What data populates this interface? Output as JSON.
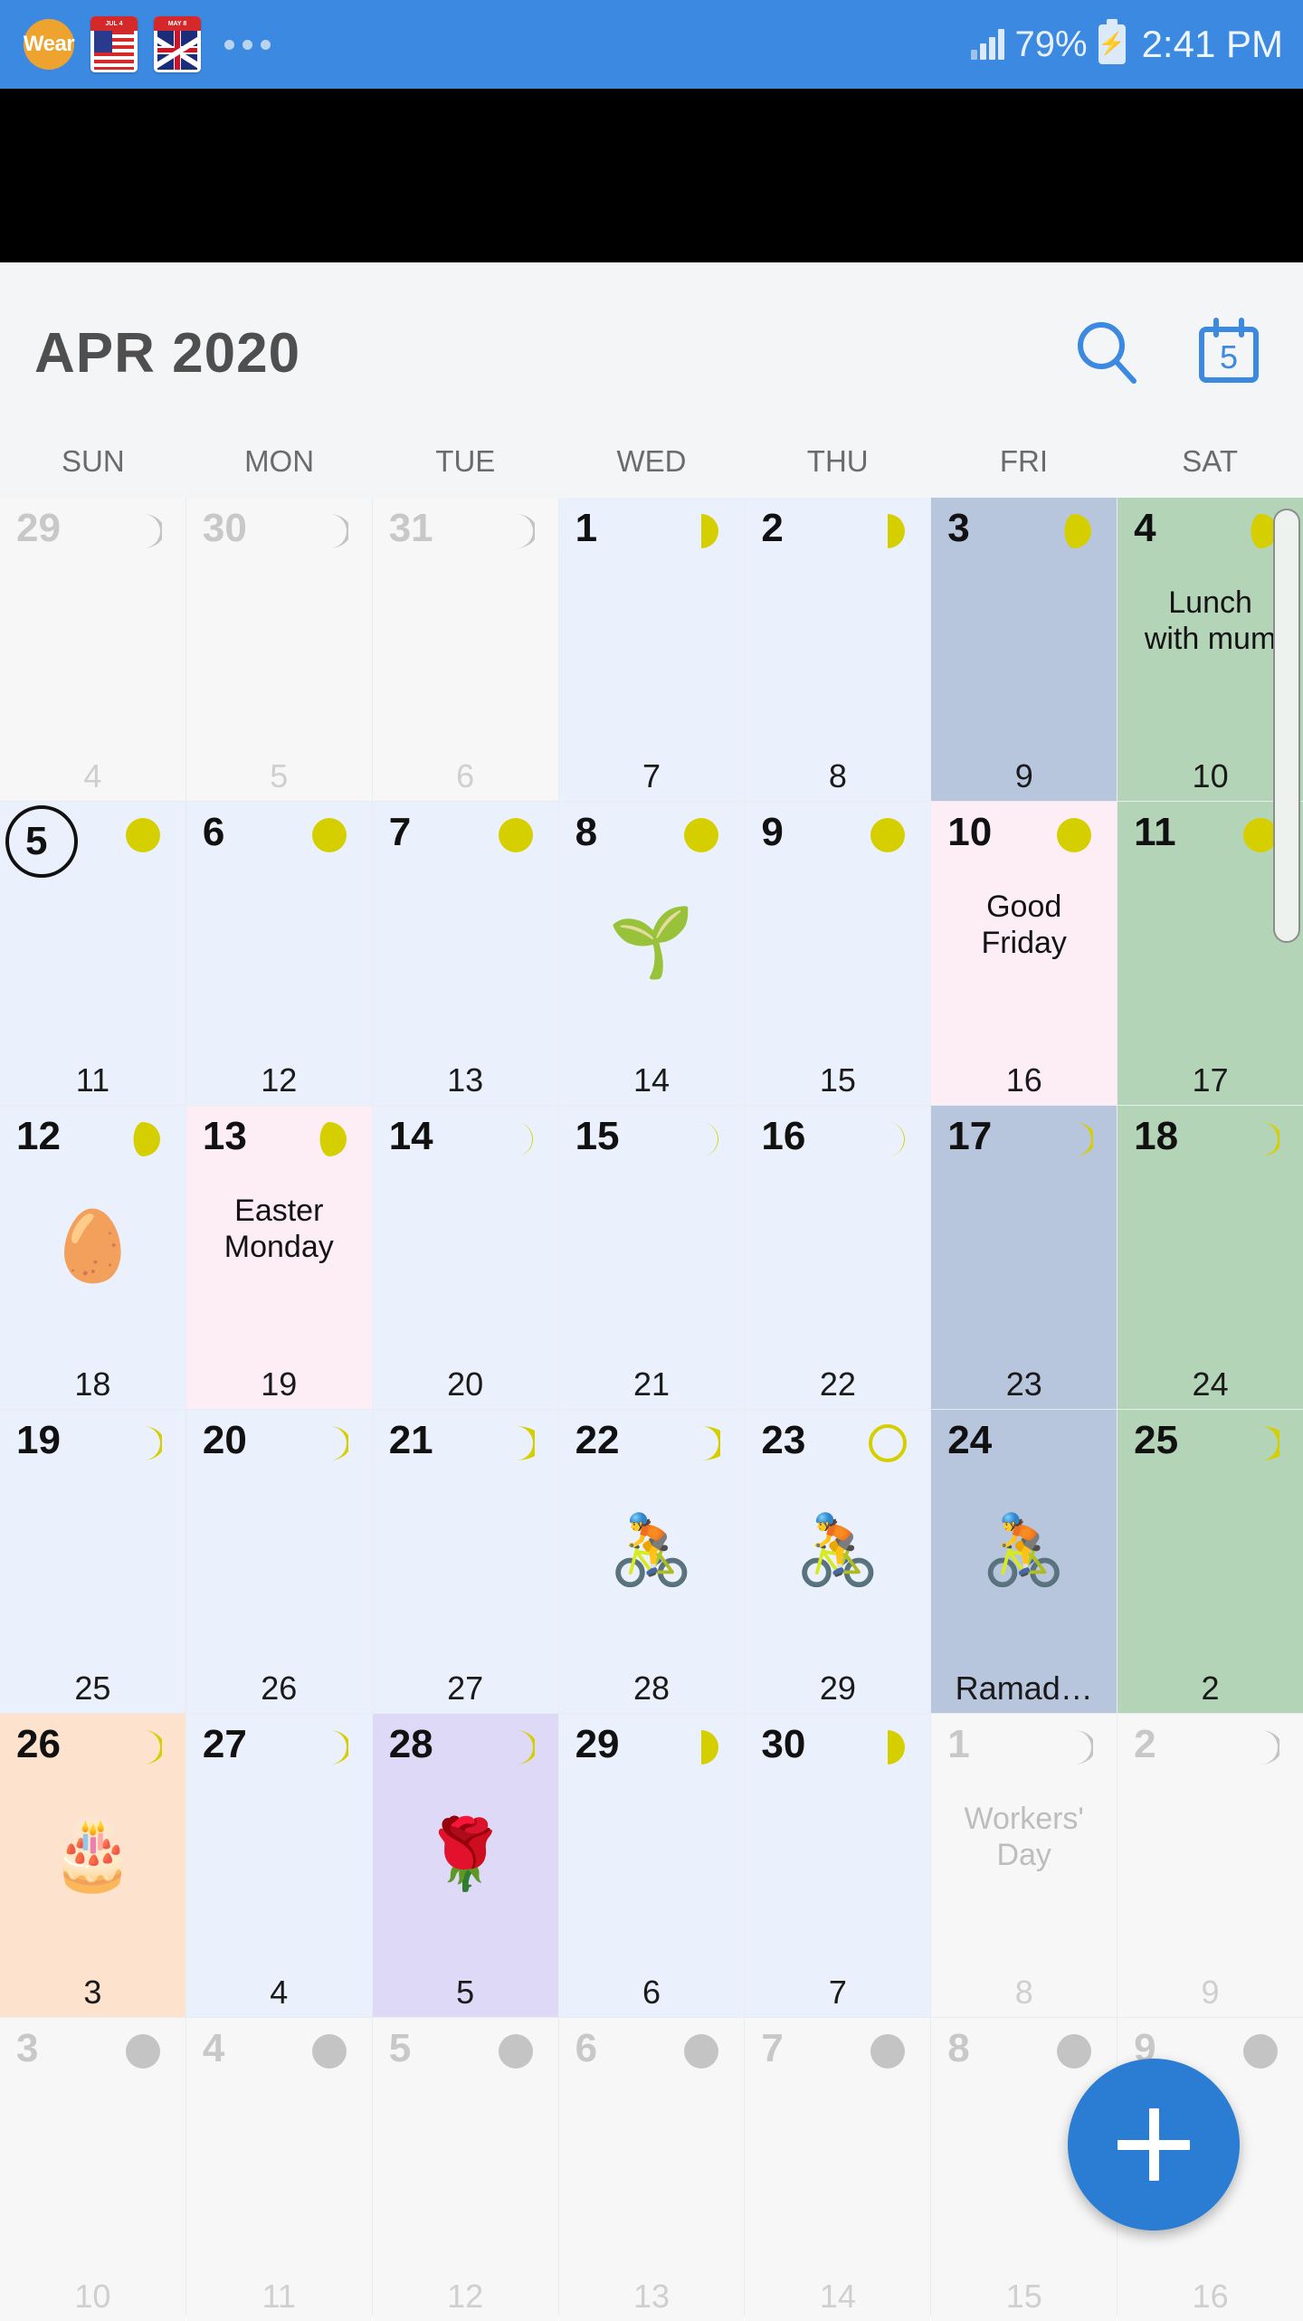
{
  "status_bar": {
    "wear_badge": "Wear",
    "us_flag_caption": "JUL 4",
    "uk_flag_caption": "MAY 8",
    "overflow_icon": "more-dots-icon",
    "signal_icon": "signal-bars-icon",
    "battery_percent": "79%",
    "battery_icon": "battery-charging-icon",
    "time": "2:41 PM",
    "background_color": "#3b89e0"
  },
  "header": {
    "title": "APR 2020",
    "search_icon": "search-icon",
    "today_icon": "calendar-today-icon",
    "today_icon_number": "5",
    "accent_color": "#3b89e0"
  },
  "weekdays": [
    "SUN",
    "MON",
    "TUE",
    "WED",
    "THU",
    "FRI",
    "SAT"
  ],
  "colors": {
    "weekday_bg": "#eaf1fc",
    "friday_bg": "#b7c5dd",
    "saturday_bg": "#b4d4b7",
    "other_month_bg": "#f7f7f8",
    "holiday_bg": "#fdeef5",
    "birthday_bg": "#fde2cd",
    "rose_bg": "#ddd9f7",
    "moon_yellow": "#d6cf00",
    "moon_gray": "#c4c4c4",
    "fab_blue": "#2b7dd4"
  },
  "fab": {
    "label": "+",
    "name": "add-event-button"
  },
  "scrollbar": {
    "name": "vertical-scrollbar"
  },
  "weeks": [
    [
      {
        "day": "29",
        "sub": "4",
        "other": true,
        "moon": "waxing-crescent-gray"
      },
      {
        "day": "30",
        "sub": "5",
        "other": true,
        "moon": "waxing-crescent-gray"
      },
      {
        "day": "31",
        "sub": "6",
        "other": true,
        "moon": "waxing-crescent-gray"
      },
      {
        "day": "1",
        "sub": "7",
        "moon": "first-quarter"
      },
      {
        "day": "2",
        "sub": "8",
        "moon": "first-quarter"
      },
      {
        "day": "3",
        "sub": "9",
        "col": "fri",
        "moon": "waxing-gibbous"
      },
      {
        "day": "4",
        "sub": "10",
        "col": "sat",
        "moon": "waxing-gibbous",
        "event": "Lunch\nwith mum"
      }
    ],
    [
      {
        "day": "5",
        "sub": "11",
        "today": true,
        "moon": "full"
      },
      {
        "day": "6",
        "sub": "12",
        "moon": "full"
      },
      {
        "day": "7",
        "sub": "13",
        "moon": "full"
      },
      {
        "day": "8",
        "sub": "14",
        "moon": "full",
        "emoji": "🌱"
      },
      {
        "day": "9",
        "sub": "15",
        "moon": "full"
      },
      {
        "day": "10",
        "sub": "16",
        "col": "holiday",
        "moon": "full",
        "event": "Good\nFriday"
      },
      {
        "day": "11",
        "sub": "17",
        "col": "sat",
        "moon": "full"
      }
    ],
    [
      {
        "day": "12",
        "sub": "18",
        "moon": "waning-gibbous",
        "emoji": "🥚"
      },
      {
        "day": "13",
        "sub": "19",
        "col": "holiday",
        "moon": "waning-gibbous",
        "event": "Easter\nMonday"
      },
      {
        "day": "14",
        "sub": "20",
        "moon": "last-quarter"
      },
      {
        "day": "15",
        "sub": "21",
        "moon": "last-quarter"
      },
      {
        "day": "16",
        "sub": "22",
        "moon": "last-quarter"
      },
      {
        "day": "17",
        "sub": "23",
        "col": "fri",
        "moon": "waning-crescent"
      },
      {
        "day": "18",
        "sub": "24",
        "col": "sat",
        "moon": "waning-crescent"
      }
    ],
    [
      {
        "day": "19",
        "sub": "25",
        "moon": "waning-crescent"
      },
      {
        "day": "20",
        "sub": "26",
        "moon": "waning-crescent"
      },
      {
        "day": "21",
        "sub": "27",
        "moon": "waning-crescent-thin"
      },
      {
        "day": "22",
        "sub": "28",
        "moon": "waning-crescent-thin",
        "emoji": "🚴"
      },
      {
        "day": "23",
        "sub": "29",
        "moon": "new",
        "emoji": "🚴"
      },
      {
        "day": "24",
        "sub": "Ramad…",
        "col": "fri",
        "emoji": "🚴",
        "sub_trunc": true
      },
      {
        "day": "25",
        "sub": "2",
        "col": "sat",
        "moon": "waxing-crescent-thin"
      }
    ],
    [
      {
        "day": "26",
        "sub": "3",
        "col": "bday",
        "moon": "waxing-crescent",
        "emoji": "🎂"
      },
      {
        "day": "27",
        "sub": "4",
        "moon": "waxing-crescent"
      },
      {
        "day": "28",
        "sub": "5",
        "col": "rose",
        "moon": "waxing-crescent",
        "emoji": "🌹"
      },
      {
        "day": "29",
        "sub": "6",
        "moon": "first-quarter-left"
      },
      {
        "day": "30",
        "sub": "7",
        "moon": "first-quarter-left"
      },
      {
        "day": "1",
        "sub": "8",
        "other": true,
        "moon": "waxing-crescent-gray",
        "event": "Workers'\nDay"
      },
      {
        "day": "2",
        "sub": "9",
        "other": true,
        "moon": "waxing-crescent-gray"
      }
    ],
    [
      {
        "day": "3",
        "sub": "10",
        "other": true,
        "moon": "gray-full"
      },
      {
        "day": "4",
        "sub": "11",
        "other": true,
        "moon": "gray-full"
      },
      {
        "day": "5",
        "sub": "12",
        "other": true,
        "moon": "gray-full"
      },
      {
        "day": "6",
        "sub": "13",
        "other": true,
        "moon": "gray-full"
      },
      {
        "day": "7",
        "sub": "14",
        "other": true,
        "moon": "gray-full"
      },
      {
        "day": "8",
        "sub": "15",
        "other": true,
        "moon": "gray-full"
      },
      {
        "day": "9",
        "sub": "16",
        "other": true,
        "moon": "gray-full"
      }
    ]
  ]
}
